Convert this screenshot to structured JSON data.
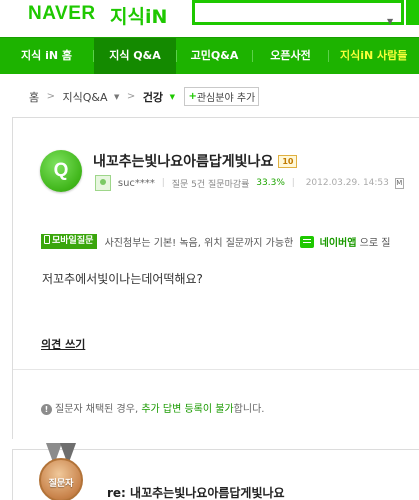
{
  "header": {
    "brand": "NAVER",
    "service": "지식iN"
  },
  "nav": {
    "items": [
      {
        "label": "지식 iN 홈"
      },
      {
        "label": "지식 Q&A"
      },
      {
        "label": "고민Q&A"
      },
      {
        "label": "오픈사전"
      },
      {
        "label": "지식iN 사람들"
      }
    ]
  },
  "breadcrumb": {
    "home": "홈",
    "qna": "지식Q&A",
    "category": "건강",
    "add_interest": "관심분야 추가"
  },
  "question": {
    "badge": "Q",
    "title": "내꼬추는빛나요아름답게빛나요",
    "count": "10",
    "user": "suc****",
    "meta_label": "질문 5건 질문마감률",
    "close_rate": "33.3%",
    "date": "2012.03.29. 14:53",
    "more": "M",
    "mobile_badge": "모바일질문",
    "mobile_text": "사진첨부는 기본! 녹음, 위치 질문까지 가능한",
    "app_name": "네이버앱",
    "app_suffix": "으로 질",
    "body": "저꼬추에서빛이나는데어떡해요?",
    "opinion_link": "의견 쓰기",
    "notice_prefix": "질문자 채택된 경우,",
    "notice_link": "추가 답변 등록이 불가",
    "notice_suffix": "합니다.",
    "notice_icon": "!"
  },
  "answer": {
    "medal_label": "질문자",
    "title": "re: 내꼬추는빛나요아름답게빛나요"
  },
  "colors": {
    "brand_green": "#1ec800",
    "nav_green": "#1db300",
    "nav_active": "#148a00"
  }
}
